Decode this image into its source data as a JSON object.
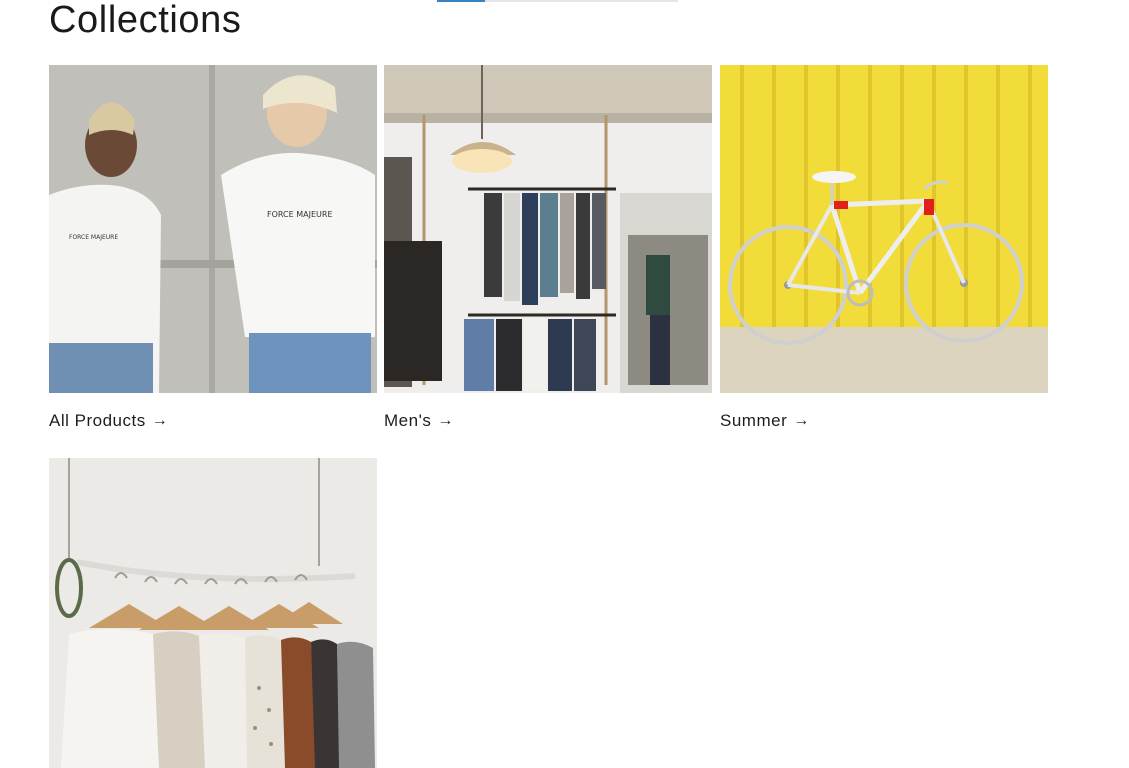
{
  "header": {
    "title": "Collections"
  },
  "collections": [
    {
      "label": "All Products",
      "icon": "arrow-right-icon",
      "arrow": "→"
    },
    {
      "label": "Men's",
      "icon": "arrow-right-icon",
      "arrow": "→"
    },
    {
      "label": "Summer",
      "icon": "arrow-right-icon",
      "arrow": "→"
    },
    {
      "label": "",
      "icon": "",
      "arrow": ""
    }
  ],
  "colors": {
    "background": "#ffffff",
    "text": "#121212",
    "summer_wall": "#f2dc3a",
    "accent": "#3b82c4"
  }
}
